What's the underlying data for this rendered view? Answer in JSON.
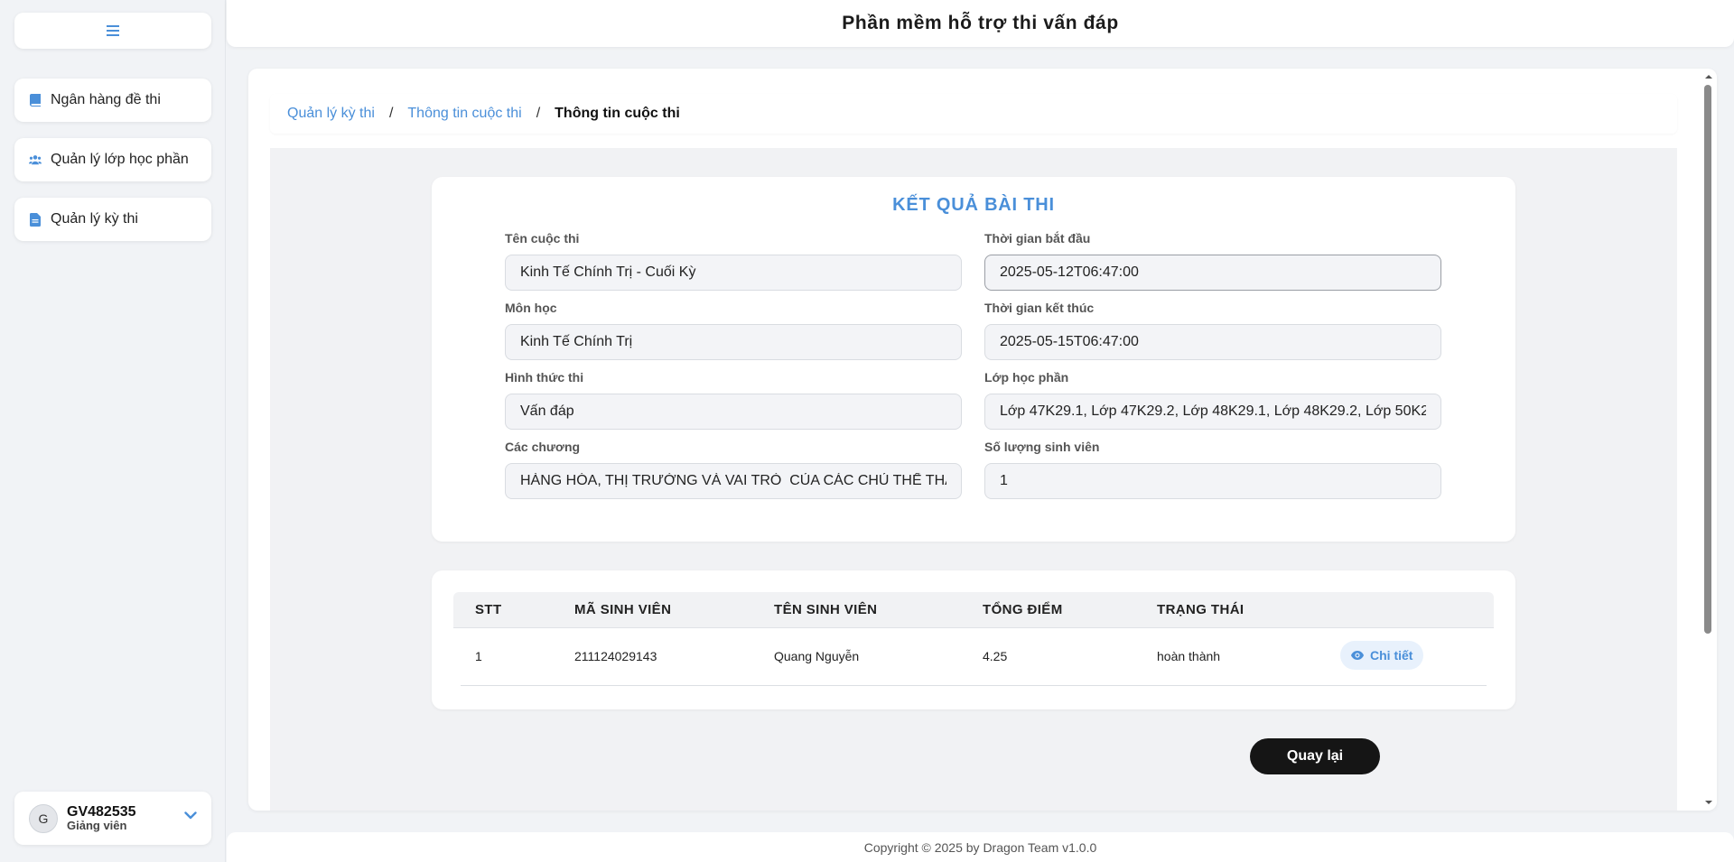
{
  "app": {
    "title": "Phần mềm hỗ trợ thi vấn đáp"
  },
  "sidebar": {
    "toggle_icon": "hamburger-icon",
    "items": [
      {
        "label": "Ngân hàng đề thi",
        "icon": "book-icon"
      },
      {
        "label": "Quản lý lớp học phần",
        "icon": "users-icon"
      },
      {
        "label": "Quản lý kỳ thi",
        "icon": "document-icon"
      }
    ],
    "user": {
      "initial": "G",
      "name": "GV482535",
      "role": "Giảng viên",
      "chevron_icon": "chevron-down-icon"
    }
  },
  "breadcrumb": {
    "items": [
      "Quản lý kỳ thi",
      "Thông tin cuộc thi"
    ],
    "current": "Thông tin cuộc thi",
    "separator": "/"
  },
  "result": {
    "title": "KẾT QUẢ BÀI THI",
    "fields": {
      "ten_cuoc_thi": {
        "label": "Tên cuộc thi",
        "value": "Kinh Tế Chính Trị - Cuối Kỳ"
      },
      "thoi_gian_bat_dau": {
        "label": "Thời gian bắt đầu",
        "value": "2025-05-12T06:47:00"
      },
      "mon_hoc": {
        "label": "Môn học",
        "value": "Kinh Tế Chính Trị"
      },
      "thoi_gian_ket_thuc": {
        "label": "Thời gian kết thúc",
        "value": "2025-05-15T06:47:00"
      },
      "hinh_thuc_thi": {
        "label": "Hình thức thi",
        "value": "Vấn đáp"
      },
      "lop_hoc_phan": {
        "label": "Lớp học phần",
        "value": "Lớp 47K29.1, Lớp 47K29.2, Lớp 48K29.1, Lớp 48K29.2, Lớp 50K2"
      },
      "cac_chuong": {
        "label": "Các chương",
        "value": "HÀNG HÓA, THỊ TRƯỜNG VÀ VAI TRÒ  CỦA CÁC CHỦ THỂ THA"
      },
      "so_luong_sinh_vien": {
        "label": "Số lượng sinh viên",
        "value": "1"
      }
    }
  },
  "table": {
    "headers": [
      "STT",
      "MÃ SINH VIÊN",
      "TÊN SINH VIÊN",
      "TỔNG ĐIỂM",
      "TRẠNG THÁI"
    ],
    "rows": [
      {
        "stt": "1",
        "ma_sv": "211124029143",
        "ten_sv": "Quang Nguyễn",
        "tong_diem": "4.25",
        "trang_thai": "hoàn thành",
        "action": "Chi tiết",
        "action_icon": "eye-icon"
      }
    ]
  },
  "back_button": {
    "label": "Quay lại"
  },
  "footer": {
    "text": "Copyright © 2025 by Dragon Team v1.0.0"
  },
  "colors": {
    "accent": "#4a8fd9",
    "dark_button": "#151515",
    "background": "#f1f3f6"
  }
}
